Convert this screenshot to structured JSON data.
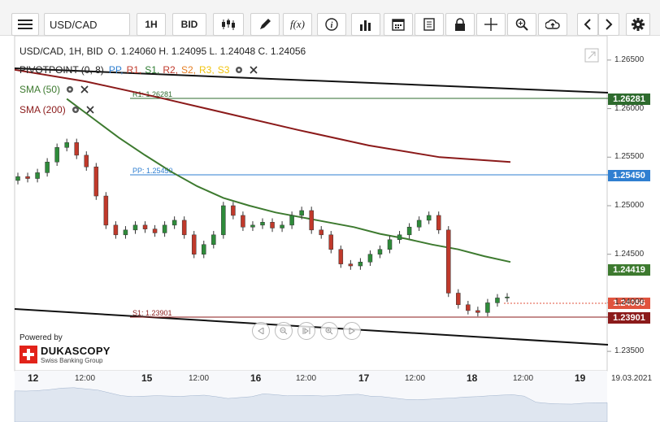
{
  "toolbar": {
    "menu_icon": "hamburger-icon",
    "symbol": "USD/CAD",
    "timeframe": "1H",
    "price_type": "BID",
    "icons": [
      "candle-type-icon",
      "pencil-icon",
      "function-icon",
      "info-icon",
      "bars-icon",
      "calendar-icon",
      "document-icon",
      "lock-icon",
      "crosshair-icon",
      "zoom-icon",
      "upload-icon",
      "prev-icon",
      "next-icon",
      "gear-icon"
    ],
    "fx_label": "f(x)"
  },
  "legend": {
    "title": "USD/CAD, 1H, BID",
    "ohlc": "O. 1.24060 H. 1.24095 L. 1.24048 C. 1.24056",
    "pivot": "PIVOTPOINT (0, 8)",
    "pivot_items": [
      "PP,",
      "R1,",
      "S1,",
      "R2,",
      "S2,",
      "R3,",
      "S3"
    ],
    "pivot_colors": [
      "#2f7fd1",
      "#c0392b",
      "#2e7d32",
      "#c0392b",
      "#e67e22",
      "#f1c40f",
      "#f1c40f"
    ],
    "sma50": "SMA (50)",
    "sma200": "SMA (200)"
  },
  "levels": {
    "r1_label": "R1: 1.26281",
    "pp_label": "PP: 1.25450",
    "s1_label": "S1: 1.23901"
  },
  "badges": {
    "r1": "1.26281",
    "pp": "1.25450",
    "sma50": "1.24419",
    "current": "1.24056",
    "s1": "1.23901"
  },
  "colors": {
    "r1": "#2e6b2e",
    "pp": "#2f7fd1",
    "sma50": "#3d7a2f",
    "sma200": "#8b1a1a",
    "current": "#e0533e",
    "s1": "#8b1a1a"
  },
  "price_axis": [
    "1.26500",
    "1.26000",
    "1.25500",
    "1.25000",
    "1.24500",
    "1.24000",
    "1.23500"
  ],
  "time_axis": {
    "dates": [
      "12",
      "15",
      "16",
      "17",
      "18",
      "19"
    ],
    "times": [
      "12:00",
      "12:00",
      "12:00",
      "12:00",
      "12:00"
    ],
    "end_date": "19.03.2021"
  },
  "branding": {
    "powered": "Powered by",
    "name": "DUKASCOPY",
    "sub": "Swiss Banking Group"
  },
  "chart_data": {
    "type": "candlestick",
    "title": "USD/CAD, 1H, BID",
    "ylim": [
      1.233,
      1.2675
    ],
    "last": {
      "open": 1.2406,
      "high": 1.24095,
      "low": 1.24048,
      "close": 1.24056
    },
    "levels": {
      "R1": 1.26281,
      "PP": 1.2545,
      "S1": 1.23901
    },
    "sma50_last": 1.24419,
    "close_series": [
      1.253,
      1.2528,
      1.2534,
      1.2545,
      1.256,
      1.2565,
      1.2552,
      1.254,
      1.251,
      1.248,
      1.247,
      1.2475,
      1.248,
      1.2476,
      1.2472,
      1.248,
      1.2485,
      1.247,
      1.245,
      1.246,
      1.247,
      1.25,
      1.249,
      1.2478,
      1.248,
      1.2483,
      1.2477,
      1.248,
      1.249,
      1.2495,
      1.2475,
      1.247,
      1.2455,
      1.244,
      1.2438,
      1.2442,
      1.245,
      1.2455,
      1.2465,
      1.247,
      1.2478,
      1.2485,
      1.249,
      1.2475,
      1.241,
      1.2398,
      1.2392,
      1.239,
      1.24,
      1.2405,
      1.2406
    ],
    "sma50_series": [
      null,
      null,
      1.261,
      1.259,
      1.257,
      1.2552,
      1.2535,
      1.252,
      1.2508,
      1.25,
      1.2493,
      1.2488,
      1.2483,
      1.2478,
      1.2471,
      1.2466,
      1.246,
      1.2455,
      1.2448,
      1.2442
    ],
    "sma200_series": [
      1.264,
      1.2628,
      1.2612,
      1.2595,
      1.2578,
      1.2562,
      1.255,
      1.2545
    ]
  }
}
